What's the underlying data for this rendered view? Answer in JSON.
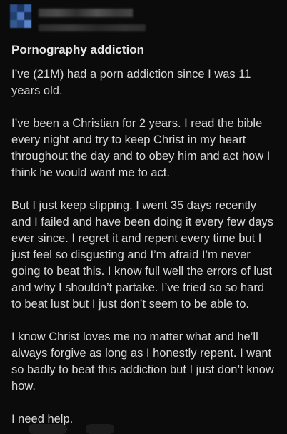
{
  "post": {
    "title": "Pornography addiction",
    "paragraphs": [
      "I’ve (21M) had a porn addiction since I was 11 years old.",
      "I’ve been a Christian for 2 years. I read the bible every night and try to keep Christ in my heart throughout the day and to obey him and act how I think he would want me to act.",
      "But I just keep slipping. I went 35 days recently and I failed and have been doing it every few days ever since. I regret it and repent every time but I just feel so disgusting and I’m afraid I’m never going to beat this. I know full well the errors of lust and why I shouldn’t partake. I’ve tried so so hard to beat lust but I just don’t seem to be able to.",
      "I know Christ loves me no matter what and he’ll always forgive as long as I honestly repent. I want so badly to beat this addiction but I just don’t know how.",
      "I need help."
    ]
  },
  "colors": {
    "background": "#0b0b0b",
    "text": "#d8d8d8",
    "title": "#e6e6e6",
    "avatar_pixels": [
      "#2d4f8a",
      "#1e3563",
      "#3b63a8",
      "#22406f",
      "#4d78c2",
      "#1a2d52",
      "#35598f",
      "#27477d",
      "#5a86cc"
    ]
  },
  "icons": {
    "avatar": "pixelated-avatar-icon"
  }
}
